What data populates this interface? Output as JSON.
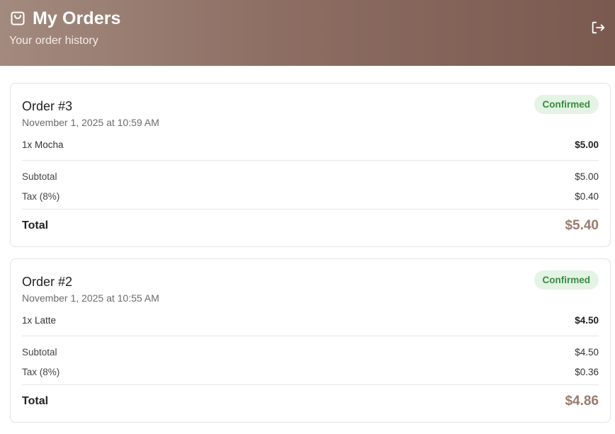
{
  "header": {
    "title": "My Orders",
    "subtitle": "Your order history",
    "icons": {
      "bag": "shopping-bag-icon",
      "logout": "logout-icon"
    }
  },
  "orders": [
    {
      "title": "Order #3",
      "date": "November 1, 2025 at 10:59 AM",
      "status": "Confirmed",
      "item": {
        "label": "1x Mocha",
        "price": "$5.00"
      },
      "subtotal_label": "Subtotal",
      "subtotal": "$5.00",
      "tax_label": "Tax (8%)",
      "tax": "$0.40",
      "total_label": "Total",
      "total": "$5.40"
    },
    {
      "title": "Order #2",
      "date": "November 1, 2025 at 10:55 AM",
      "status": "Confirmed",
      "item": {
        "label": "1x Latte",
        "price": "$4.50"
      },
      "subtotal_label": "Subtotal",
      "subtotal": "$4.50",
      "tax_label": "Tax (8%)",
      "tax": "$0.36",
      "total_label": "Total",
      "total": "$4.86"
    }
  ],
  "colors": {
    "header_gradient": [
      "#a38a7e",
      "#8d6e63",
      "#7a5a4f"
    ],
    "status_bg": "#e3f4e4",
    "status_text": "#3a8a42",
    "total_accent": "#9a7b6c"
  }
}
